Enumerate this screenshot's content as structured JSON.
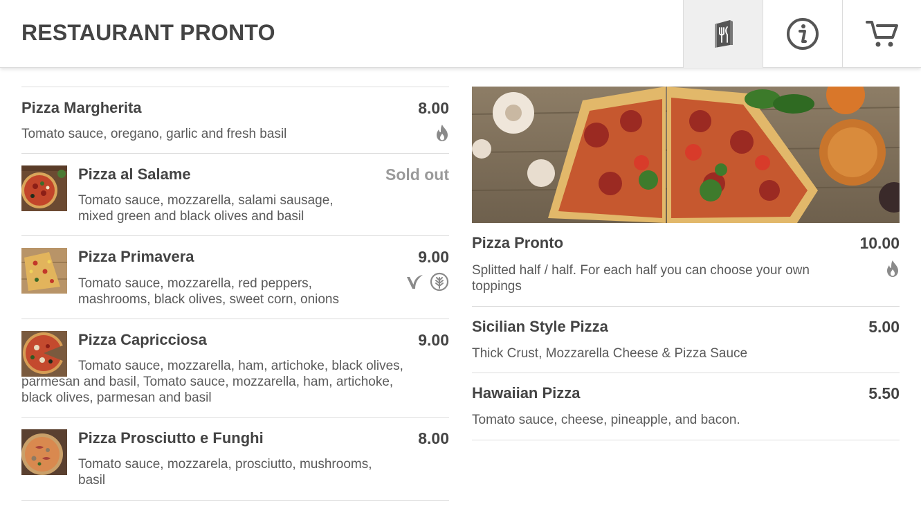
{
  "header": {
    "title": "RESTAURANT PRONTO",
    "buttons": [
      {
        "icon": "menu-book-icon",
        "active": true
      },
      {
        "icon": "info-icon",
        "active": false
      },
      {
        "icon": "cart-icon",
        "active": false
      }
    ]
  },
  "menu_left": [
    {
      "name": "Pizza Margherita",
      "price": "8.00",
      "description": "Tomato sauce, oregano, garlic and fresh basil",
      "tags": [
        "spicy-icon"
      ],
      "has_thumb": false
    },
    {
      "name": "Pizza al Salame",
      "price": "Sold out",
      "sold_out": true,
      "description": "Tomato sauce, mozzarella, salami sausage, mixed green and black olives and basil",
      "tags": [],
      "has_thumb": true
    },
    {
      "name": "Pizza Primavera",
      "price": "9.00",
      "description": "Tomato sauce, mozzarella, red peppers, mashrooms, black olives, sweet corn, onions",
      "tags": [
        "vegan-icon",
        "vegetarian-icon"
      ],
      "has_thumb": true
    },
    {
      "name": "Pizza Capricciosa",
      "price": "9.00",
      "description": "Tomato sauce, mozzarella, ham, artichoke, black olives, parmesan and basil, Tomato sauce, mozzarella, ham, artichoke, black olives, parmesan and basil",
      "tags": [],
      "has_thumb": true
    },
    {
      "name": "Pizza Prosciutto e Funghi",
      "price": "8.00",
      "description": "Tomato sauce, mozzarela, prosciutto, mushrooms, basil",
      "tags": [],
      "has_thumb": true
    }
  ],
  "menu_right": [
    {
      "name": "Pizza Pronto",
      "price": "10.00",
      "description": "Splitted half / half. For each half you can choose your own toppings",
      "tags": [
        "spicy-icon"
      ]
    },
    {
      "name": "Sicilian Style Pizza",
      "price": "5.00",
      "description": "Thick Crust, Mozzarella Cheese & Pizza Sauce",
      "tags": []
    },
    {
      "name": "Hawaiian Pizza",
      "price": "5.50",
      "description": "Tomato sauce, cheese, pineapple, and bacon.",
      "tags": []
    }
  ],
  "colors": {
    "text": "#444444",
    "muted": "#9a9a9a",
    "divider": "#dcdcdc",
    "active_tab": "#efefef"
  }
}
